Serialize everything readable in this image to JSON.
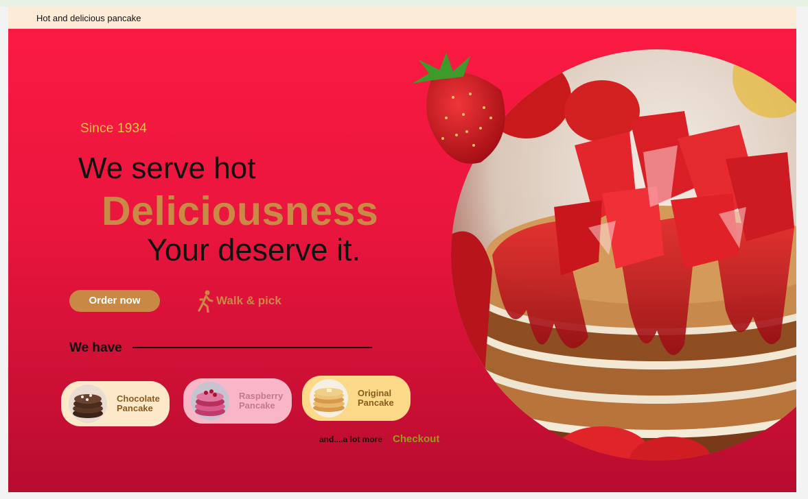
{
  "header": {
    "brand": "Hot and delicious pancake"
  },
  "hero": {
    "since": "Since 1934",
    "line1": "We serve hot",
    "line2": "Deliciousness",
    "line3": "Your deserve it.",
    "order_label": "Order now",
    "walk_label": "Walk & pick",
    "walk_icon": "walking-person-icon"
  },
  "menu": {
    "title": "We have",
    "items": [
      {
        "line1": "Chocolate",
        "line2": "Pancake"
      },
      {
        "line1": "Raspberry",
        "line2": "Pancake"
      },
      {
        "line1": "Original",
        "line2": "Pancake"
      }
    ],
    "more": "and....a lot more",
    "checkout": "Checkout"
  },
  "colors": {
    "accent": "#c98945",
    "hero_top": "#fb1a42",
    "hero_bottom": "#b80c2f",
    "topbar": "#fcebd7",
    "since": "#f1c24a"
  }
}
